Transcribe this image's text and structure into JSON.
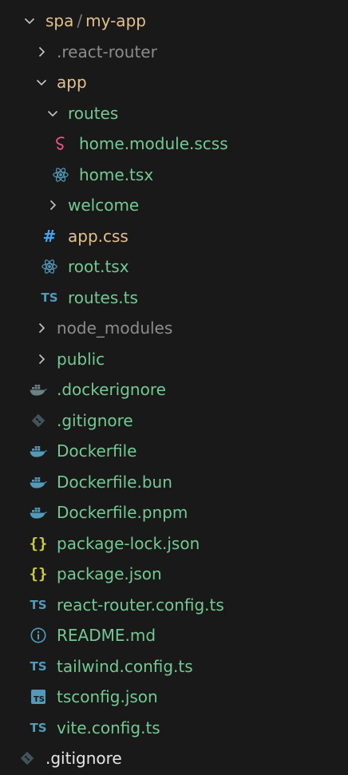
{
  "colors": {
    "background": "#191919",
    "folder_modified": "#e2c08d",
    "file_added": "#73c991",
    "ignored": "#8c8c8c",
    "chevron": "#c5c5c5"
  },
  "tree": {
    "root": {
      "part1": "spa",
      "sep": "/",
      "part2": "my-app"
    },
    "items": [
      {
        "label": ".react-router",
        "icon": "chevron-right-icon"
      },
      {
        "label": "app",
        "icon": "chevron-down-icon"
      },
      {
        "label": "routes",
        "icon": "chevron-down-icon"
      },
      {
        "label": "home.module.scss",
        "icon": "sass-icon"
      },
      {
        "label": "home.tsx",
        "icon": "react-icon"
      },
      {
        "label": "welcome",
        "icon": "chevron-right-icon"
      },
      {
        "label": "app.css",
        "icon": "css-hash-icon"
      },
      {
        "label": "root.tsx",
        "icon": "react-icon"
      },
      {
        "label": "routes.ts",
        "icon": "typescript-icon"
      },
      {
        "label": "node_modules",
        "icon": "chevron-right-icon"
      },
      {
        "label": "public",
        "icon": "chevron-right-icon"
      },
      {
        "label": ".dockerignore",
        "icon": "docker-icon"
      },
      {
        "label": ".gitignore",
        "icon": "git-icon"
      },
      {
        "label": "Dockerfile",
        "icon": "docker-icon"
      },
      {
        "label": "Dockerfile.bun",
        "icon": "docker-icon"
      },
      {
        "label": "Dockerfile.pnpm",
        "icon": "docker-icon"
      },
      {
        "label": "package-lock.json",
        "icon": "json-icon"
      },
      {
        "label": "package.json",
        "icon": "json-icon"
      },
      {
        "label": "react-router.config.ts",
        "icon": "typescript-icon"
      },
      {
        "label": "README.md",
        "icon": "info-icon"
      },
      {
        "label": "tailwind.config.ts",
        "icon": "typescript-icon"
      },
      {
        "label": "tsconfig.json",
        "icon": "tsconfig-icon"
      },
      {
        "label": "vite.config.ts",
        "icon": "typescript-icon"
      },
      {
        "label": ".gitignore",
        "icon": "git-icon"
      }
    ],
    "ts_badge": "TS",
    "json_badge": "{}",
    "hash_badge": "#"
  }
}
